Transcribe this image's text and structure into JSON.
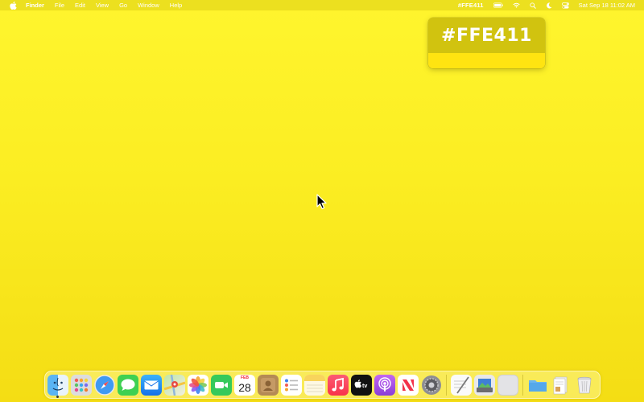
{
  "menubar": {
    "app_name": "Finder",
    "menus": [
      "File",
      "Edit",
      "View",
      "Go",
      "Window",
      "Help"
    ],
    "hex_status": "#FFE411",
    "datetime": "Sat Sep 18  11:02 AM"
  },
  "popover": {
    "hex": "#FFE411",
    "swatch_color": "#FFE411"
  },
  "dock": {
    "calendar_month": "FEB",
    "calendar_day": "28",
    "apps": [
      "Finder",
      "Launchpad",
      "Safari",
      "Messages",
      "Mail",
      "Maps",
      "Photos",
      "FaceTime",
      "Calendar",
      "Contacts",
      "Reminders",
      "Notes",
      "Music",
      "TV",
      "Podcasts",
      "News",
      "System Preferences",
      "TextEdit",
      "Preview",
      "Blank App",
      "Folder",
      "Document",
      "Trash"
    ]
  },
  "colors": {
    "desktop": "#FFE411",
    "accent": "#D1C30F"
  }
}
